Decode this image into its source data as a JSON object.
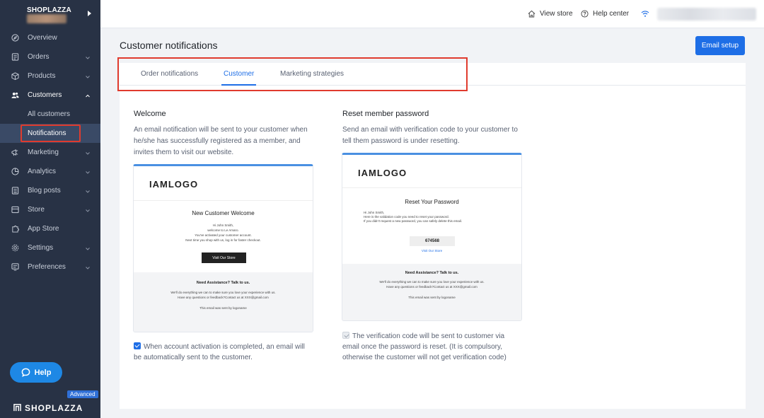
{
  "sidebar": {
    "store_name": "SHOPLAZZA",
    "items": [
      {
        "label": "Overview",
        "icon": "compass-icon",
        "chevron": false
      },
      {
        "label": "Orders",
        "icon": "orders-icon",
        "chevron": true
      },
      {
        "label": "Products",
        "icon": "box-icon",
        "chevron": true
      },
      {
        "label": "Customers",
        "icon": "users-icon",
        "chevron": true,
        "expanded": true
      },
      {
        "label": "All customers",
        "sub": true
      },
      {
        "label": "Notifications",
        "sub": true,
        "selected": true
      },
      {
        "label": "Marketing",
        "icon": "megaphone-icon",
        "chevron": true
      },
      {
        "label": "Analytics",
        "icon": "pie-chart-icon",
        "chevron": true
      },
      {
        "label": "Blog posts",
        "icon": "document-icon",
        "chevron": true
      },
      {
        "label": "Store",
        "icon": "store-icon",
        "chevron": true
      },
      {
        "label": "App Store",
        "icon": "puzzle-icon",
        "chevron": false
      },
      {
        "label": "Settings",
        "icon": "gear-icon",
        "chevron": true
      },
      {
        "label": "Preferences",
        "icon": "monitor-icon",
        "chevron": true
      }
    ],
    "help_label": "Help",
    "badge": "Advanced",
    "brand": "SHOPLAZZA"
  },
  "topbar": {
    "view_store": "View store",
    "help_center": "Help center"
  },
  "page": {
    "title": "Customer notifications",
    "email_setup": "Email setup",
    "tabs": [
      "Order notifications",
      "Customer",
      "Marketing strategies"
    ],
    "active_tab": "Customer"
  },
  "welcome": {
    "title": "Welcome",
    "desc": "An email notification will be sent to your customer when he/she has successfully registered as a member, and invites them to visit our website.",
    "preview": {
      "logo": "IAMLOGO",
      "heading": "New Customer Welcome",
      "line1": "Hi  John Smith,",
      "line2": "welcome to Le Amaro.",
      "line3": "You've activated your customer account.",
      "line4": "Next time you shop with us, log in for faster checkout.",
      "button": "Visit Our Store",
      "footer_title": "Need Assistance? Talk to us.",
      "footer_line1": "We'll do everything we can to make sure you love your experience with us.",
      "footer_line2": "Have any questions or feedback?Contact us at XXX@gmail.com",
      "footer_sent": "This email was sent by logoname"
    },
    "checkbox_label": "When account activation is completed, an email will be automatically sent to the customer.",
    "checked": true
  },
  "reset": {
    "title": "Reset member password",
    "desc": "Send an email with verification code to your customer to tell them password is under resetting.",
    "preview": {
      "logo": "IAMLOGO",
      "heading": "Reset Your Password",
      "line1": "Hi  John Smith,",
      "line2": "Here is the validation code you need to reset your password.",
      "line3": "If you didn't request a new password, you can safely delete this email.",
      "code": "674568",
      "link": "Visit Our Store",
      "footer_title": "Need Assistance? Talk to us.",
      "footer_line1": "We'll do everything we can to make sure you love your experience with us.",
      "footer_line2": "Have any questions or feedback?Contact us at XXX@gmail.com",
      "footer_sent": "This email was sent by logoname"
    },
    "checkbox_label": "The verification code will be sent to customer via email once the password is reset. (It is compulsory, otherwise the customer will not get verification code)",
    "checked": true,
    "disabled": true
  }
}
